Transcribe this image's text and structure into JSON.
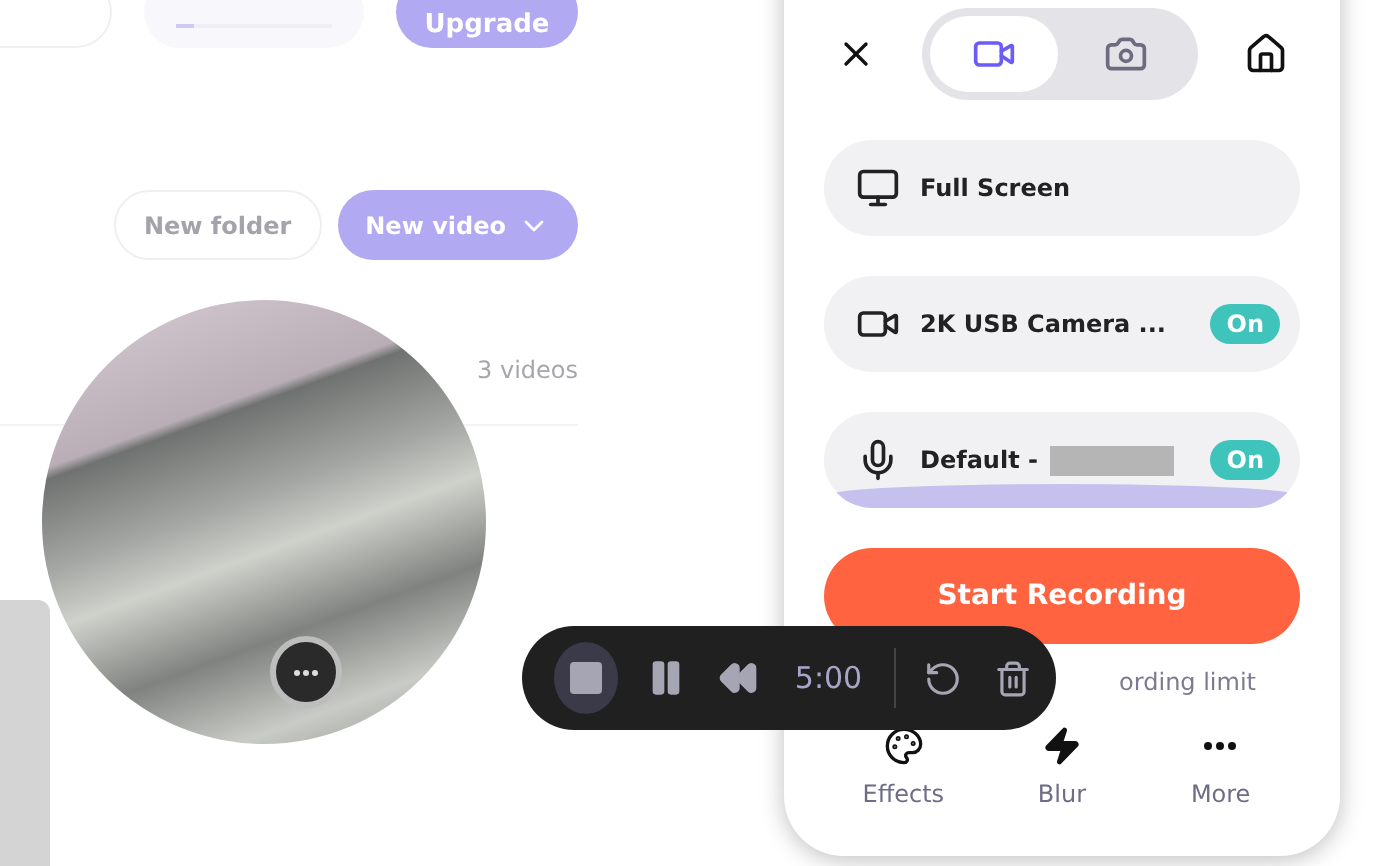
{
  "background": {
    "top_bar": {
      "progress": {
        "level": 0.12
      },
      "upgrade_button": "Upgrade"
    },
    "actions": [
      {
        "kind": "outline",
        "label": "New folder"
      },
      {
        "kind": "primary",
        "label": "New video"
      }
    ],
    "video_count": "3 videos"
  },
  "recorder_toolbar": {
    "timer": "5:00"
  },
  "panel": {
    "modes": [
      {
        "kind": "video",
        "selected": true
      },
      {
        "kind": "photo",
        "selected": false
      }
    ],
    "sources": [
      {
        "kind": "screen",
        "label": "Full Screen"
      },
      {
        "kind": "camera",
        "label": "2K USB Camera ...",
        "on": true,
        "toggle_label": "On"
      },
      {
        "kind": "mic",
        "label": "Default -",
        "redacted": true,
        "on": true,
        "toggle_label": "On",
        "level": 1
      }
    ],
    "start_button": "Start Recording",
    "limit_note": "ording limit",
    "actions": [
      {
        "kind": "effects",
        "label": "Effects"
      },
      {
        "kind": "blur",
        "label": "Blur"
      },
      {
        "kind": "more",
        "label": "More"
      }
    ]
  }
}
